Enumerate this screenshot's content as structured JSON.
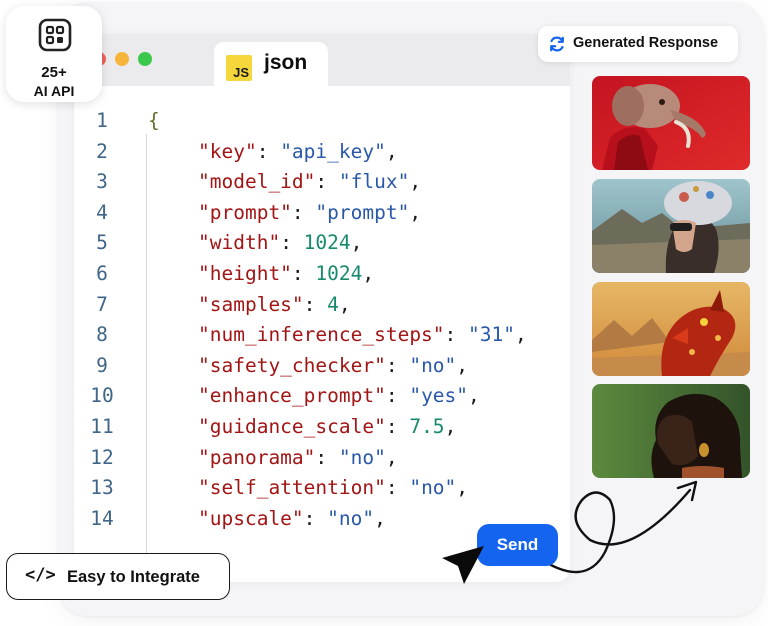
{
  "editor": {
    "tab_label": "json",
    "tab_icon_text": "JS",
    "open_brace": "{",
    "lines": [
      {
        "num": "1",
        "parts": []
      },
      {
        "num": "2",
        "parts": [
          [
            "k",
            "\"key\""
          ],
          [
            "p",
            ": "
          ],
          [
            "s",
            "\"api_key\""
          ],
          [
            "p",
            ","
          ]
        ]
      },
      {
        "num": "3",
        "parts": [
          [
            "k",
            "\"model_id\""
          ],
          [
            "p",
            ": "
          ],
          [
            "s",
            "\"flux\""
          ],
          [
            "p",
            ","
          ]
        ]
      },
      {
        "num": "4",
        "parts": [
          [
            "k",
            "\"prompt\""
          ],
          [
            "p",
            ": "
          ],
          [
            "s",
            "\"prompt\""
          ],
          [
            "p",
            ","
          ]
        ]
      },
      {
        "num": "5",
        "parts": [
          [
            "k",
            "\"width\""
          ],
          [
            "p",
            ": "
          ],
          [
            "n",
            "1024"
          ],
          [
            "p",
            ","
          ]
        ]
      },
      {
        "num": "6",
        "parts": [
          [
            "k",
            "\"height\""
          ],
          [
            "p",
            ": "
          ],
          [
            "n",
            "1024"
          ],
          [
            "p",
            ","
          ]
        ]
      },
      {
        "num": "7",
        "parts": [
          [
            "k",
            "\"samples\""
          ],
          [
            "p",
            ": "
          ],
          [
            "n",
            "4"
          ],
          [
            "p",
            ","
          ]
        ]
      },
      {
        "num": "8",
        "parts": [
          [
            "k",
            "\"num_inference_steps\""
          ],
          [
            "p",
            ": "
          ],
          [
            "s",
            "\"31\""
          ],
          [
            "p",
            ","
          ]
        ]
      },
      {
        "num": "9",
        "parts": [
          [
            "k",
            "\"safety_checker\""
          ],
          [
            "p",
            ": "
          ],
          [
            "s",
            "\"no\""
          ],
          [
            "p",
            ","
          ]
        ]
      },
      {
        "num": "10",
        "parts": [
          [
            "k",
            "\"enhance_prompt\""
          ],
          [
            "p",
            ": "
          ],
          [
            "s",
            "\"yes\""
          ],
          [
            "p",
            ","
          ]
        ]
      },
      {
        "num": "11",
        "parts": [
          [
            "k",
            "\"guidance_scale\""
          ],
          [
            "p",
            ": "
          ],
          [
            "n",
            "7.5"
          ],
          [
            "p",
            ","
          ]
        ]
      },
      {
        "num": "12",
        "parts": [
          [
            "k",
            "\"panorama\""
          ],
          [
            "p",
            ": "
          ],
          [
            "s",
            "\"no\""
          ],
          [
            "p",
            ","
          ]
        ]
      },
      {
        "num": "13",
        "parts": [
          [
            "k",
            "\"self_attention\""
          ],
          [
            "p",
            ": "
          ],
          [
            "s",
            "\"no\""
          ],
          [
            "p",
            ","
          ]
        ]
      },
      {
        "num": "14",
        "parts": [
          [
            "k",
            "\"upscale\""
          ],
          [
            "p",
            ": "
          ],
          [
            "s",
            "\"no\""
          ],
          [
            "p",
            ","
          ]
        ]
      }
    ]
  },
  "badges": {
    "api_count": "25+",
    "api_label": "AI API",
    "api_icon": "grid-apps-icon",
    "generated_label": "Generated Response",
    "generated_icon": "refresh-icon",
    "integrate_label": "Easy to Integrate",
    "integrate_icon": "</>"
  },
  "actions": {
    "send_label": "Send"
  },
  "images": [
    "woman-with-elephant-head-in-red-coat",
    "woman-with-steampunk-headpiece",
    "golden-dragon-in-desert",
    "portrait-of-woman-with-earring"
  ],
  "colors": {
    "accent": "#1464f0",
    "key": "#a31515",
    "string": "#2a58a8",
    "number": "#178a6e",
    "line_number": "#3f6688"
  }
}
